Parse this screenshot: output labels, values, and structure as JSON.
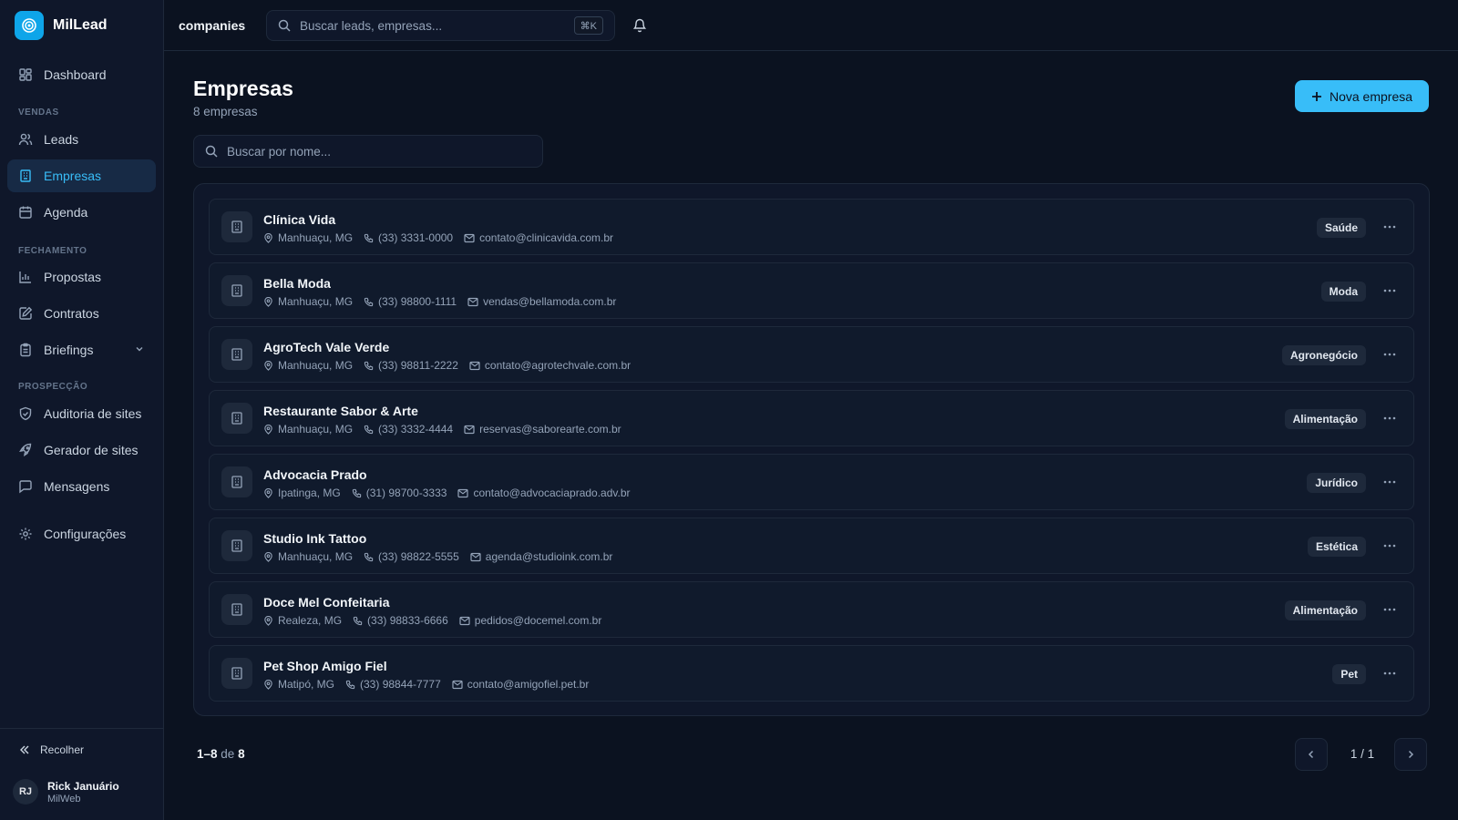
{
  "app": {
    "name": "MilLead"
  },
  "sidebar": {
    "dashboard": "Dashboard",
    "sections": {
      "vendas": "VENDAS",
      "fechamento": "FECHAMENTO",
      "prospeccao": "PROSPECÇÃO"
    },
    "items": {
      "leads": "Leads",
      "empresas": "Empresas",
      "agenda": "Agenda",
      "propostas": "Propostas",
      "contratos": "Contratos",
      "briefings": "Briefings",
      "auditoria": "Auditoria de sites",
      "gerador": "Gerador de sites",
      "mensagens": "Mensagens",
      "configuracoes": "Configurações"
    },
    "active": "empresas",
    "collapse_label": "Recolher",
    "user": {
      "initials": "RJ",
      "name": "Rick Januário",
      "org": "MilWeb"
    }
  },
  "topbar": {
    "breadcrumb": "companies",
    "search_placeholder": "Buscar leads, empresas...",
    "shortcut": "⌘K"
  },
  "page": {
    "title": "Empresas",
    "subtitle": "8 empresas",
    "new_button": "Nova empresa",
    "search_placeholder": "Buscar por nome..."
  },
  "companies": [
    {
      "name": "Clínica Vida",
      "location": "Manhuaçu, MG",
      "phone": "(33) 3331-0000",
      "email": "contato@clinicavida.com.br",
      "tag": "Saúde"
    },
    {
      "name": "Bella Moda",
      "location": "Manhuaçu, MG",
      "phone": "(33) 98800-1111",
      "email": "vendas@bellamoda.com.br",
      "tag": "Moda"
    },
    {
      "name": "AgroTech Vale Verde",
      "location": "Manhuaçu, MG",
      "phone": "(33) 98811-2222",
      "email": "contato@agrotechvale.com.br",
      "tag": "Agronegócio"
    },
    {
      "name": "Restaurante Sabor & Arte",
      "location": "Manhuaçu, MG",
      "phone": "(33) 3332-4444",
      "email": "reservas@saborearte.com.br",
      "tag": "Alimentação"
    },
    {
      "name": "Advocacia Prado",
      "location": "Ipatinga, MG",
      "phone": "(31) 98700-3333",
      "email": "contato@advocaciaprado.adv.br",
      "tag": "Jurídico"
    },
    {
      "name": "Studio Ink Tattoo",
      "location": "Manhuaçu, MG",
      "phone": "(33) 98822-5555",
      "email": "agenda@studioink.com.br",
      "tag": "Estética"
    },
    {
      "name": "Doce Mel Confeitaria",
      "location": "Realeza, MG",
      "phone": "(33) 98833-6666",
      "email": "pedidos@docemel.com.br",
      "tag": "Alimentação"
    },
    {
      "name": "Pet Shop Amigo Fiel",
      "location": "Matipó, MG",
      "phone": "(33) 98844-7777",
      "email": "contato@amigofiel.pet.br",
      "tag": "Pet"
    }
  ],
  "pagination": {
    "range": "1–8",
    "of": "de",
    "total": "8",
    "page": "1 / 1"
  },
  "colors": {
    "accent": "#38bdf8",
    "background": "#0b1220",
    "sidebar": "#0f172a",
    "active_item": "#172a45"
  }
}
